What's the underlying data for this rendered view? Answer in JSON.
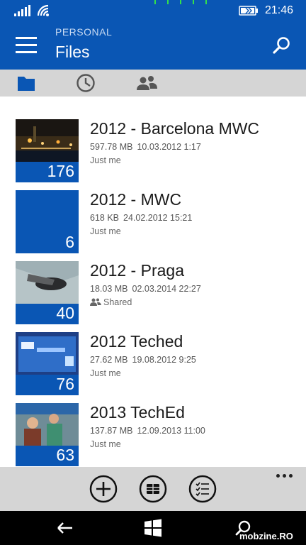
{
  "status_bar": {
    "time": "21:46",
    "signal_icon": "signal-bars-icon",
    "wifi_icon": "wifi-icon",
    "battery_icon": "battery-icon"
  },
  "header": {
    "subtitle": "PERSONAL",
    "title": "Files",
    "menu_icon": "hamburger-icon",
    "search_icon": "search-icon"
  },
  "tabs": [
    {
      "icon": "folder-icon",
      "active": true
    },
    {
      "icon": "clock-icon",
      "active": false
    },
    {
      "icon": "people-icon",
      "active": false
    }
  ],
  "folders": [
    {
      "title": "2012 - Barcelona MWC",
      "size": "597.78 MB",
      "date": "10.03.2012 1:17",
      "owner": "Just me",
      "shared": false,
      "count": "176",
      "thumb": "night-city-photo"
    },
    {
      "title": "2012 - MWC",
      "size": "618 KB",
      "date": "24.02.2012 15:21",
      "owner": "Just me",
      "shared": false,
      "count": "6",
      "thumb": "none"
    },
    {
      "title": "2012 - Praga",
      "size": "18.03 MB",
      "date": "02.03.2014 22:27",
      "owner": "Shared",
      "shared": true,
      "count": "40",
      "thumb": "hand-photo"
    },
    {
      "title": "2012 Teched",
      "size": "27.62 MB",
      "date": "19.08.2012 9:25",
      "owner": "Just me",
      "shared": false,
      "count": "76",
      "thumb": "screen-photo"
    },
    {
      "title": "2013 TechEd",
      "size": "137.87 MB",
      "date": "12.09.2013 11:00",
      "owner": "Just me",
      "shared": false,
      "count": "63",
      "thumb": "people-photo"
    }
  ],
  "app_bar": {
    "buttons": [
      "add-icon",
      "grid-view-icon",
      "select-list-icon"
    ],
    "more_icon": "more-dots-icon"
  },
  "nav_bar": {
    "buttons": [
      "back-icon",
      "windows-start-icon",
      "search-icon"
    ]
  },
  "watermark": "mobzine.RO",
  "colors": {
    "accent": "#0a56b4",
    "tab_bar": "#d5d5d5",
    "nav_bar": "#000000"
  }
}
